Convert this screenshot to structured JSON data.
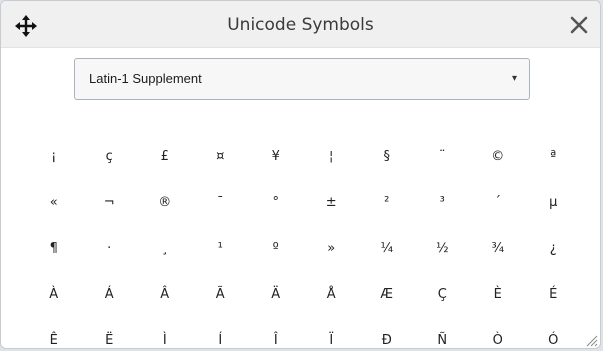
{
  "dialog": {
    "title": "Unicode Symbols",
    "move_icon": "move-arrows-icon",
    "close_icon": "close-x-icon"
  },
  "block_select": {
    "selected": "Latin-1 Supplement",
    "arrow": "▾"
  },
  "symbols": [
    "¡",
    "ç",
    "£",
    "¤",
    "¥",
    "¦",
    "§",
    "¨",
    "©",
    "ª",
    "«",
    "¬",
    "®",
    "¯",
    "°",
    "±",
    "²",
    "³",
    "´",
    "µ",
    "¶",
    "·",
    "¸",
    "¹",
    "º",
    "»",
    "¼",
    "½",
    "¾",
    "¿",
    "À",
    "Á",
    "Â",
    "Ã",
    "Ä",
    "Å",
    "Æ",
    "Ç",
    "È",
    "É",
    "Ê",
    "Ë",
    "Ì",
    "Í",
    "Î",
    "Ï",
    "Ð",
    "Ñ",
    "Ò",
    "Ó"
  ],
  "colors": {
    "titlebar_bg": "#f0f0f0",
    "dialog_bg": "#ffffff",
    "text": "#222222"
  }
}
